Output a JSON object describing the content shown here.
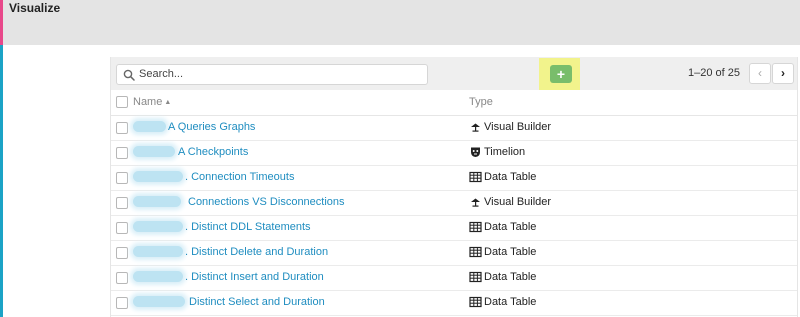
{
  "header": {
    "title": "Visualize"
  },
  "search": {
    "placeholder": "Search..."
  },
  "toolbar": {
    "create_label": "+"
  },
  "pagination": {
    "range": "1–20 of 25",
    "prev_label": "‹",
    "next_label": "›"
  },
  "table": {
    "columns": {
      "name": "Name",
      "type": "Type",
      "sort": "▲"
    },
    "rows": [
      {
        "name": "A Queries Graphs",
        "type": "Visual Builder",
        "icon": "visual-builder-icon"
      },
      {
        "name": "A Checkpoints",
        "type": "Timelion",
        "icon": "timelion-icon"
      },
      {
        "name": ". Connection Timeouts",
        "type": "Data Table",
        "icon": "data-table-icon"
      },
      {
        "name": "Connections VS Disconnections",
        "type": "Visual Builder",
        "icon": "visual-builder-icon"
      },
      {
        "name": ". Distinct DDL Statements",
        "type": "Data Table",
        "icon": "data-table-icon"
      },
      {
        "name": ". Distinct Delete and Duration",
        "type": "Data Table",
        "icon": "data-table-icon"
      },
      {
        "name": ". Distinct Insert and Duration",
        "type": "Data Table",
        "icon": "data-table-icon"
      },
      {
        "name": "Distinct Select and Duration",
        "type": "Data Table",
        "icon": "data-table-icon"
      }
    ]
  },
  "colors": {
    "link": "#1f8dc0",
    "create": "#79bd6b",
    "highlight": "#f2f38c",
    "accent_pink": "#e8488a",
    "accent_blue": "#1ba3c6"
  }
}
